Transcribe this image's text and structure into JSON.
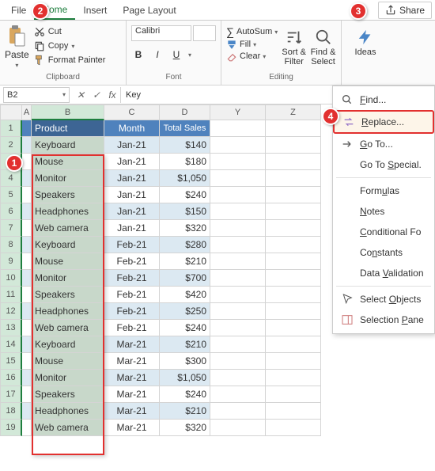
{
  "tabs": {
    "file": "File",
    "home": "Home",
    "insert": "Insert",
    "page_layout": "Page Layout"
  },
  "share": "Share",
  "ribbon": {
    "clipboard": {
      "paste": "Paste",
      "cut": "Cut",
      "copy": "Copy",
      "format_painter": "Format Painter",
      "label": "Clipboard"
    },
    "font": {
      "name": "Calibri",
      "size": "",
      "bold": "B",
      "italic": "I",
      "underline": "U",
      "label": "Font"
    },
    "editing": {
      "autosum": "AutoSum",
      "fill": "Fill",
      "clear": "Clear",
      "sort": "Sort & Filter",
      "find": "Find & Select",
      "label": "Editing"
    },
    "ideas": "Ideas"
  },
  "namebox": "B2",
  "formula_value": "Key",
  "headers": {
    "product": "Product",
    "month": "Month",
    "total": "Total Sales"
  },
  "cols": [
    "A",
    "B",
    "C",
    "D",
    "Y",
    "Z"
  ],
  "data": [
    {
      "p": "Keyboard",
      "m": "Jan-21",
      "s": "$140"
    },
    {
      "p": "Mouse",
      "m": "Jan-21",
      "s": "$180"
    },
    {
      "p": "Monitor",
      "m": "Jan-21",
      "s": "$1,050"
    },
    {
      "p": "Speakers",
      "m": "Jan-21",
      "s": "$240"
    },
    {
      "p": "Headphones",
      "m": "Jan-21",
      "s": "$150"
    },
    {
      "p": "Web camera",
      "m": "Jan-21",
      "s": "$320"
    },
    {
      "p": "Keyboard",
      "m": "Feb-21",
      "s": "$280"
    },
    {
      "p": "Mouse",
      "m": "Feb-21",
      "s": "$210"
    },
    {
      "p": "Monitor",
      "m": "Feb-21",
      "s": "$700"
    },
    {
      "p": "Speakers",
      "m": "Feb-21",
      "s": "$420"
    },
    {
      "p": "Headphones",
      "m": "Feb-21",
      "s": "$250"
    },
    {
      "p": "Web camera",
      "m": "Feb-21",
      "s": "$240"
    },
    {
      "p": "Keyboard",
      "m": "Mar-21",
      "s": "$210"
    },
    {
      "p": "Mouse",
      "m": "Mar-21",
      "s": "$300"
    },
    {
      "p": "Monitor",
      "m": "Mar-21",
      "s": "$1,050"
    },
    {
      "p": "Speakers",
      "m": "Mar-21",
      "s": "$240"
    },
    {
      "p": "Headphones",
      "m": "Mar-21",
      "s": "$210"
    },
    {
      "p": "Web camera",
      "m": "Mar-21",
      "s": "$320"
    }
  ],
  "menu": {
    "find": "Find...",
    "replace": "Replace...",
    "goto": "Go To...",
    "goto_special": "Go To Special.",
    "formulas": "Formulas",
    "notes": "Notes",
    "cond": "Conditional Fo",
    "constants": "Constants",
    "dv": "Data Validation",
    "sel_obj": "Select Objects",
    "sel_pane": "Selection Pane"
  },
  "badges": {
    "b1": "1",
    "b2": "2",
    "b3": "3",
    "b4": "4"
  }
}
